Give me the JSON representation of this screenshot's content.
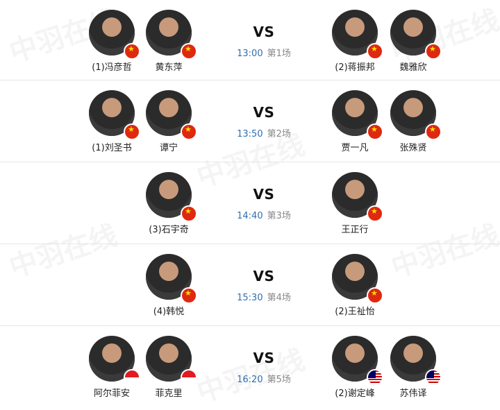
{
  "matches": [
    {
      "time": "13:00",
      "order": "第1场",
      "left": [
        {
          "name": "(1)冯彦哲",
          "flag": "cn"
        },
        {
          "name": "黄东萍",
          "flag": "cn"
        }
      ],
      "right": [
        {
          "name": "(2)蒋振邦",
          "flag": "cn"
        },
        {
          "name": "魏雅欣",
          "flag": "cn"
        }
      ]
    },
    {
      "time": "13:50",
      "order": "第2场",
      "left": [
        {
          "name": "(1)刘圣书",
          "flag": "cn"
        },
        {
          "name": "谭宁",
          "flag": "cn"
        }
      ],
      "right": [
        {
          "name": "贾一凡",
          "flag": "cn"
        },
        {
          "name": "张殊贤",
          "flag": "cn"
        }
      ]
    },
    {
      "time": "14:40",
      "order": "第3场",
      "left": [
        {
          "name": "(3)石宇奇",
          "flag": "cn"
        }
      ],
      "right": [
        {
          "name": "王正行",
          "flag": "cn"
        }
      ]
    },
    {
      "time": "15:30",
      "order": "第4场",
      "left": [
        {
          "name": "(4)韩悦",
          "flag": "cn"
        }
      ],
      "right": [
        {
          "name": "(2)王祉怡",
          "flag": "cn"
        }
      ]
    },
    {
      "time": "16:20",
      "order": "第5场",
      "left": [
        {
          "name": "阿尔菲安",
          "flag": "id"
        },
        {
          "name": "菲克里",
          "flag": "id"
        }
      ],
      "right": [
        {
          "name": "(2)谢定峰",
          "flag": "my"
        },
        {
          "name": "苏伟译",
          "flag": "my"
        }
      ]
    }
  ],
  "vs_label": "VS",
  "watermark": "中羽在线"
}
